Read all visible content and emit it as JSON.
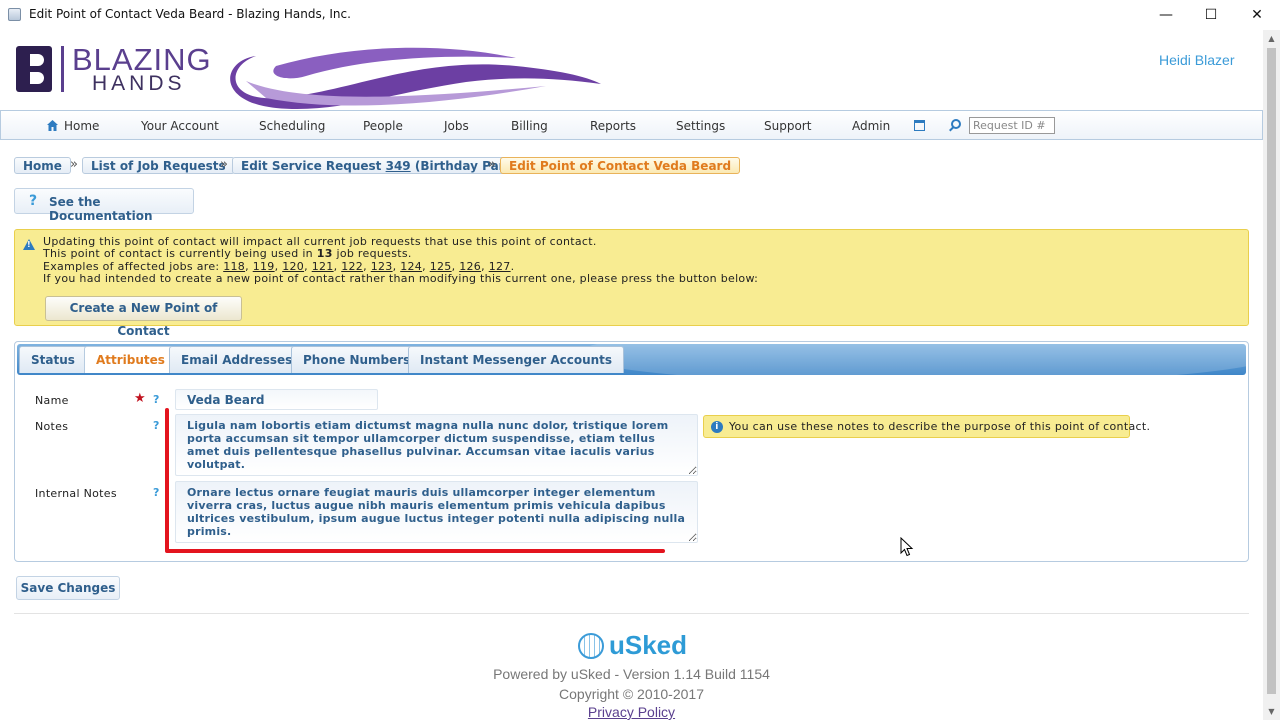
{
  "window": {
    "title": "Edit Point of Contact Veda Beard - Blazing Hands, Inc.",
    "min_glyph": "—",
    "max_glyph": "☐",
    "close_glyph": "✕"
  },
  "header": {
    "logo_word1": "BLAZING",
    "logo_word2": "HANDS",
    "username": "Heidi Blazer"
  },
  "nav": {
    "items": [
      "Home",
      "Your Account",
      "Scheduling",
      "People",
      "Jobs",
      "Billing",
      "Reports",
      "Settings",
      "Support",
      "Admin"
    ],
    "request_placeholder": "Request ID #"
  },
  "breadcrumb": {
    "home": "Home",
    "list": "List of Job Requests",
    "edit_prefix": "Edit Service Request ",
    "edit_number": "349",
    "edit_suffix": " (Birthday Party)",
    "current": "Edit Point of Contact Veda Beard",
    "separator": "»"
  },
  "doc_button": "See the Documentation",
  "warning": {
    "line1": "Updating this point of contact will impact all current job requests that use this point of contact.",
    "line2_pre": "This point of contact is currently being used in ",
    "line2_count": "13",
    "line2_post": " job requests.",
    "line3_pre": "Examples of affected jobs are: ",
    "jobs": [
      "118",
      "119",
      "120",
      "121",
      "122",
      "123",
      "124",
      "125",
      "126",
      "127"
    ],
    "line4": "If you had intended to create a new point of contact rather than modifying this current one, please press the button below:",
    "button": "Create a New Point of Contact"
  },
  "tabs": [
    "Status",
    "Attributes",
    "Email Addresses",
    "Phone Numbers",
    "Instant Messenger Accounts"
  ],
  "form": {
    "name_label": "Name",
    "name_value": "Veda Beard",
    "notes_label": "Notes",
    "notes_value": "Ligula nam lobortis etiam dictumst magna nulla nunc dolor, tristique lorem porta accumsan sit tempor ullamcorper dictum suspendisse, etiam tellus amet duis pellentesque phasellus pulvinar. Accumsan vitae iaculis varius volutpat.",
    "internal_label": "Internal Notes",
    "internal_value": "Ornare lectus ornare feugiat mauris duis ullamcorper integer elementum viverra cras, luctus augue nibh mauris elementum primis vehicula dapibus ultrices vestibulum, ipsum augue luctus integer potenti nulla adipiscing nulla primis.",
    "notes_tip": "You can use these notes to describe the purpose of this point of contact.",
    "required_glyph": "★",
    "help_glyph": "?"
  },
  "save_button": "Save Changes",
  "footer": {
    "brand": "uSked",
    "powered": "Powered by uSked - Version 1.14 Build 1154",
    "copyright": "Copyright © 2010-2017",
    "privacy": "Privacy Policy"
  },
  "colors": {
    "accent": "#2f5f8c",
    "active_tab": "#e07b1e",
    "warning_bg": "#f8ec92",
    "annotation": "#e3141e"
  }
}
